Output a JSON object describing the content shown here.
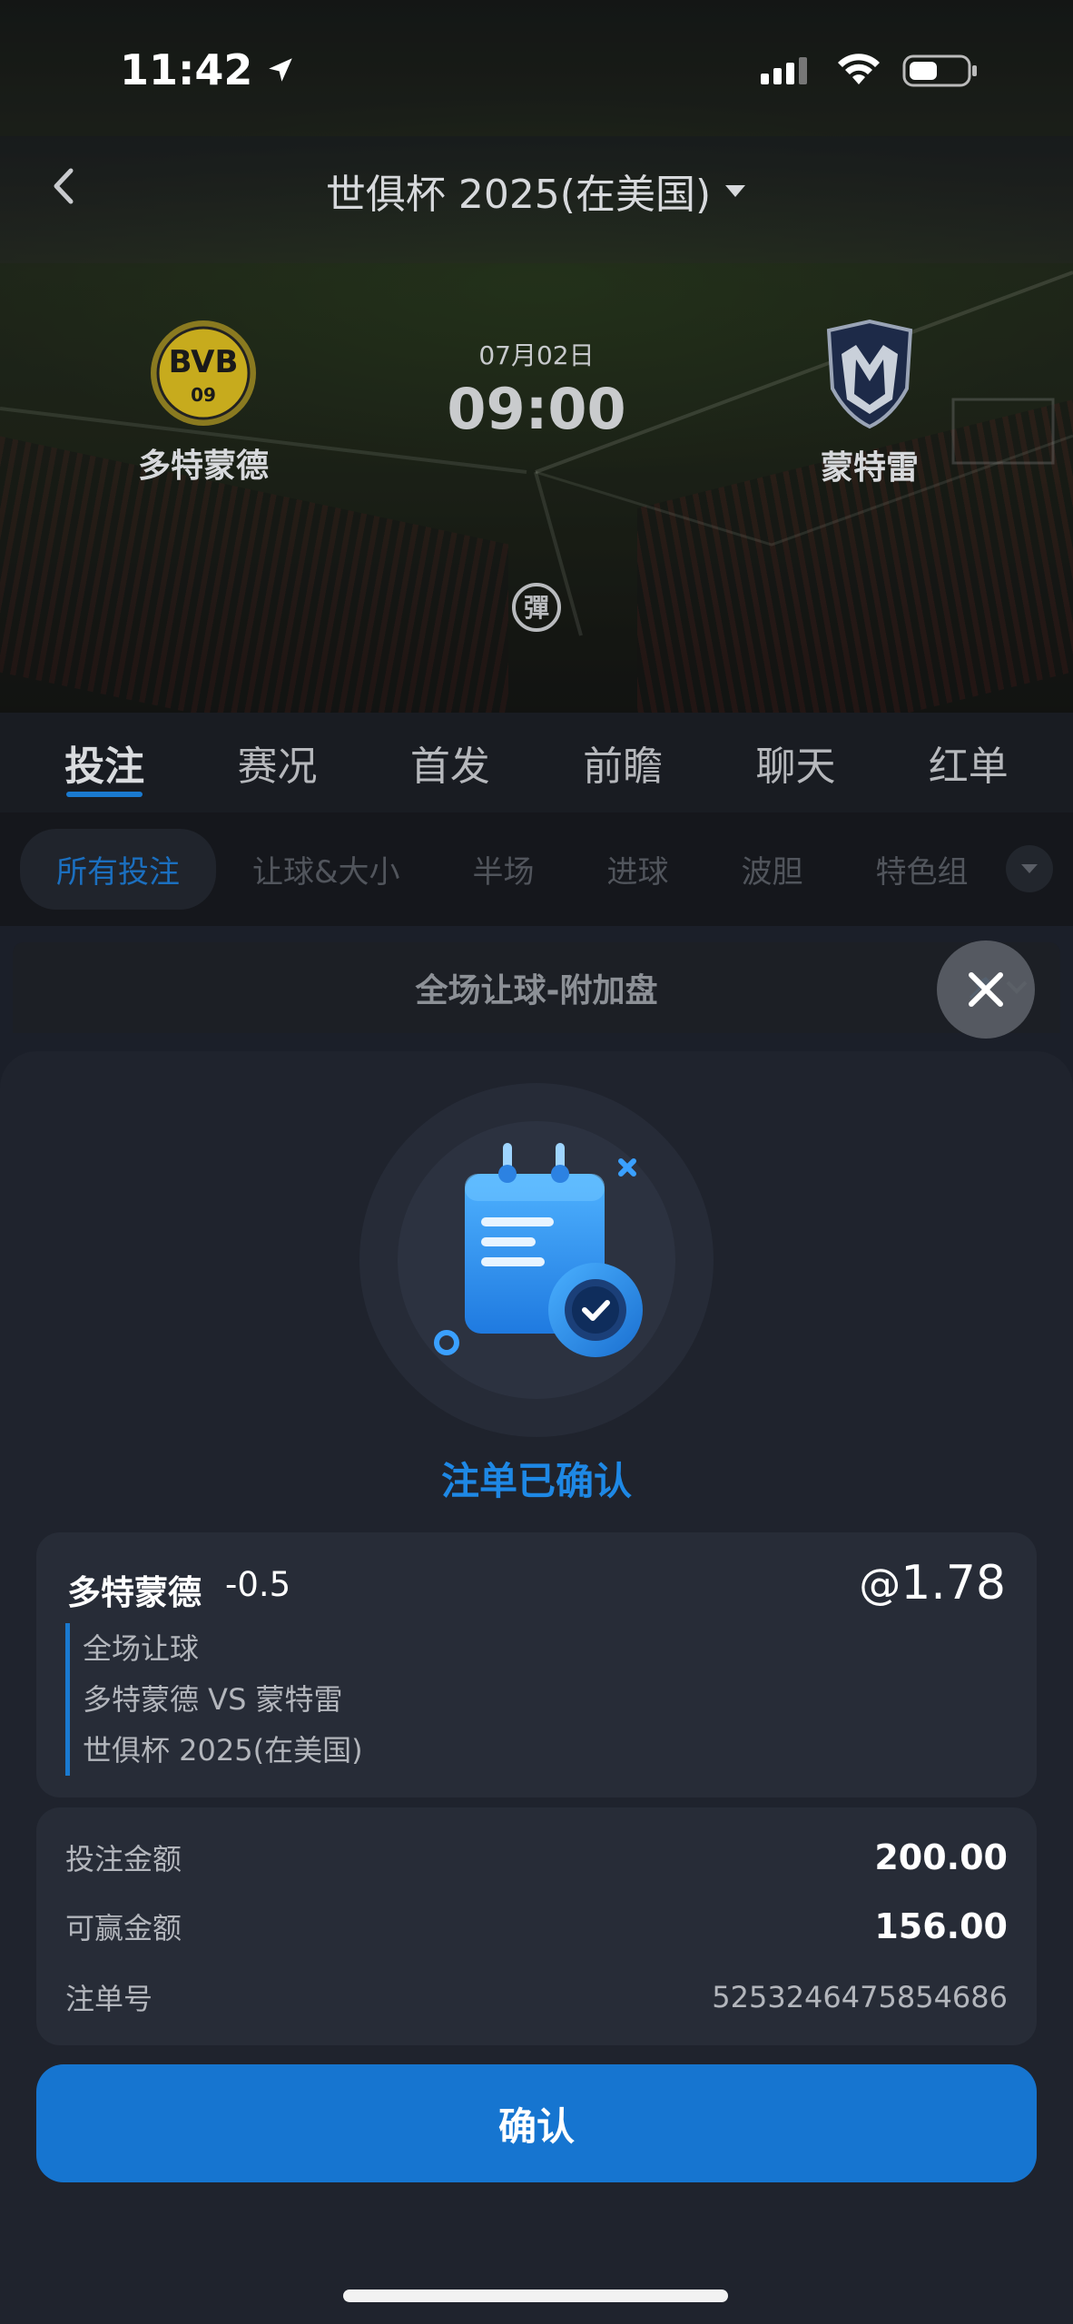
{
  "status_bar": {
    "time": "11:42"
  },
  "header": {
    "competition": "世俱杯 2025(在美国)",
    "home_team": "多特蒙德",
    "away_team": "蒙特雷",
    "date": "07月02日",
    "time": "09:00",
    "live_badge": "彈"
  },
  "tabs": [
    "投注",
    "赛况",
    "首发",
    "前瞻",
    "聊天",
    "红单"
  ],
  "subtabs": [
    "所有投注",
    "让球&大小",
    "半场",
    "进球",
    "波胆",
    "特色组"
  ],
  "market": {
    "title": "全场让球-附加盘"
  },
  "confirmation": {
    "title": "注单已确认",
    "pick_team": "多特蒙德",
    "pick_line": "-0.5",
    "odds_prefix": "@",
    "odds": "1.78",
    "bet_type": "全场让球",
    "matchup": "多特蒙德 VS 蒙特雷",
    "competition": "世俱杯 2025(在美国)",
    "stake_label": "投注金额",
    "stake_value": "200.00",
    "win_label": "可赢金额",
    "win_value": "156.00",
    "ticket_label": "注单号",
    "ticket_value": "5253246475854686",
    "confirm_button": "确认"
  },
  "colors": {
    "accent": "#1675d0",
    "title_blue": "#1e88e5",
    "sheet_bg": "#1f232d",
    "card_bg": "#272c37"
  }
}
